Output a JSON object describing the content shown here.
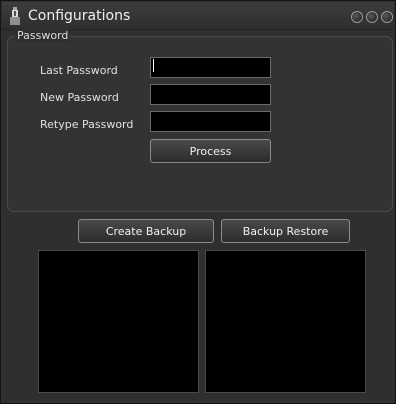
{
  "window": {
    "title": "Configurations",
    "controls": [
      "minimize",
      "maximize",
      "close"
    ]
  },
  "password_group": {
    "label": "Password",
    "fields": [
      {
        "label": "Last Password",
        "value": ""
      },
      {
        "label": "New Password",
        "value": ""
      },
      {
        "label": "Retype Password",
        "value": ""
      }
    ],
    "process_label": "Process"
  },
  "backup": {
    "create_label": "Create Backup",
    "restore_label": "Backup Restore"
  }
}
